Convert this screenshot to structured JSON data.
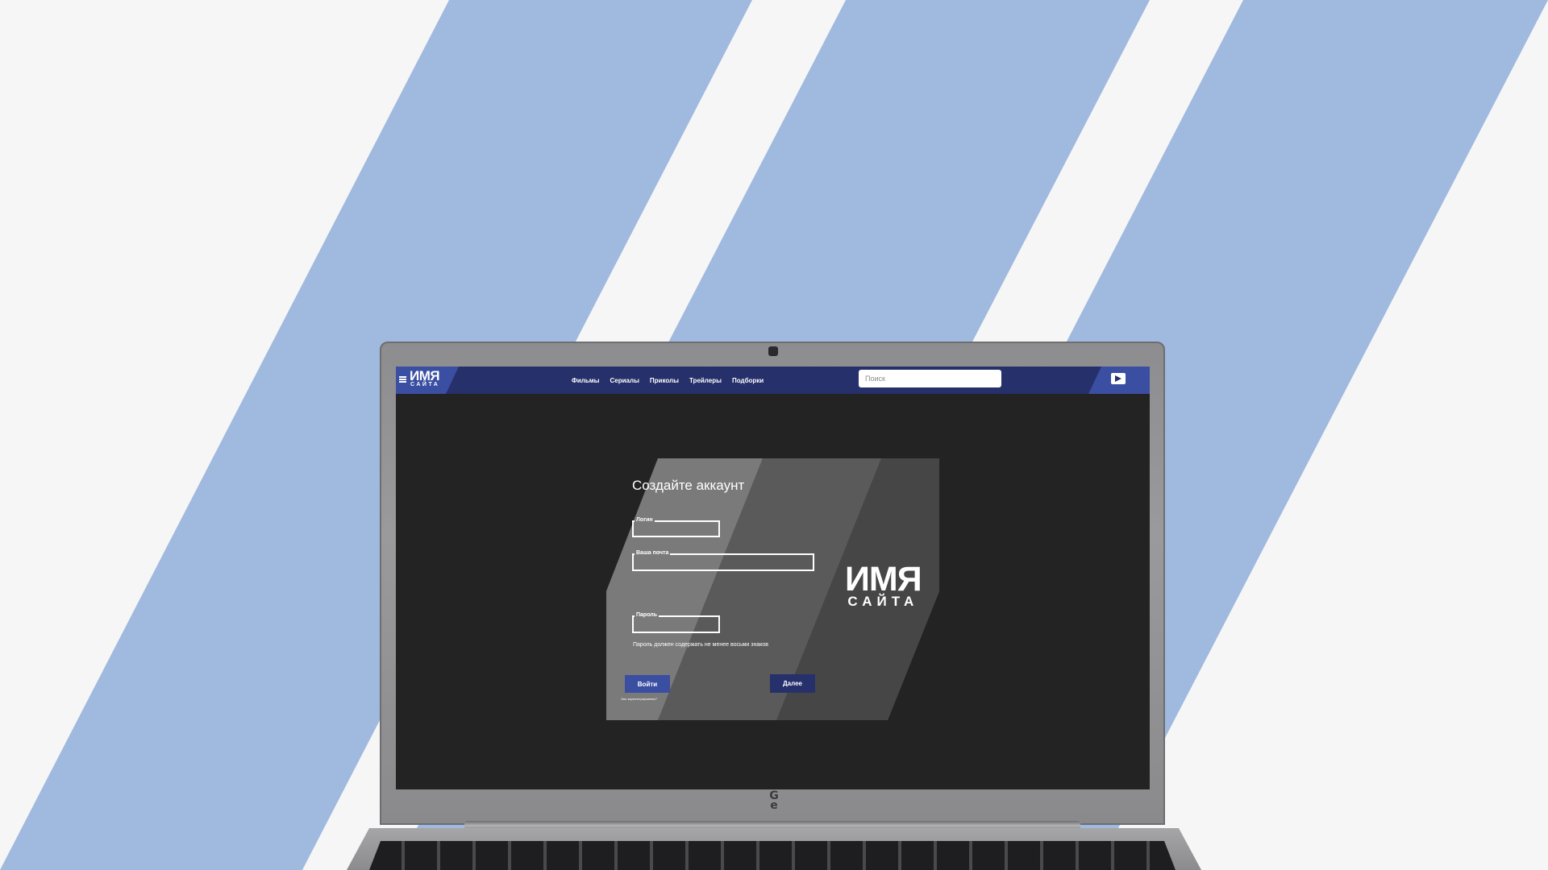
{
  "brand": {
    "name_top": "ИМЯ",
    "name_bottom": "САЙТА"
  },
  "nav": {
    "links": [
      {
        "label": "Фильмы"
      },
      {
        "label": "Сериалы"
      },
      {
        "label": "Приколы"
      },
      {
        "label": "Трейлеры"
      },
      {
        "label": "Подборки"
      }
    ]
  },
  "search": {
    "placeholder": "Поиск",
    "value": ""
  },
  "signup": {
    "title": "Создайте аккаунт",
    "login_label": "Логин",
    "email_label": "Ваша почта",
    "password_label": "Пароль",
    "password_hint": "Пароль должен содержать не менее восьми знаков",
    "login_button": "Войти",
    "next_button": "Далее",
    "already_registered": "Уже зарегистрированы?"
  },
  "card_logo": {
    "name_top": "ИМЯ",
    "name_bottom": "САЙТА"
  },
  "colors": {
    "navbar": "#26306a",
    "accent": "#3a4ea2",
    "screen_bg": "#232323",
    "card": "#5a5a5a",
    "stripe": "#a0b9de"
  },
  "icons": {
    "menu": "hamburger-icon",
    "video": "video-upload-icon"
  }
}
